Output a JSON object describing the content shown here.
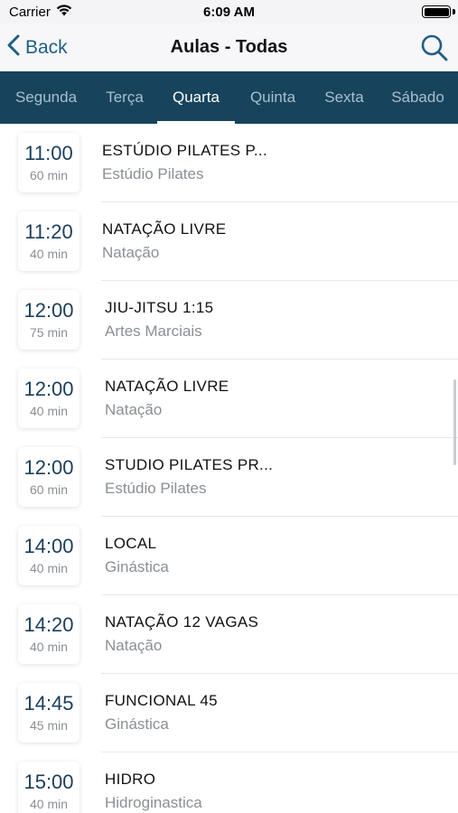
{
  "status_bar": {
    "carrier": "Carrier",
    "time": "6:09 AM",
    "icons": [
      "wifi-icon",
      "battery-icon"
    ]
  },
  "nav": {
    "back_label": "Back",
    "title": "Aulas - Todas",
    "icons": [
      "chevron-left-icon",
      "search-icon"
    ]
  },
  "day_tabs": [
    {
      "label": "Segunda",
      "active": false
    },
    {
      "label": "Terça",
      "active": false
    },
    {
      "label": "Quarta",
      "active": true
    },
    {
      "label": "Quinta",
      "active": false
    },
    {
      "label": "Sexta",
      "active": false
    },
    {
      "label": "Sábado",
      "active": false
    }
  ],
  "classes": [
    {
      "time": "11:00",
      "duration": "60 min",
      "name": "ESTÚDIO PILATES P...",
      "category": "Estúdio Pilates"
    },
    {
      "time": "11:20",
      "duration": "40 min",
      "name": "NATAÇÃO LIVRE",
      "category": "Natação"
    },
    {
      "time": "12:00",
      "duration": "75 min",
      "name": "JIU-JITSU 1:15",
      "category": "Artes Marciais"
    },
    {
      "time": "12:00",
      "duration": "40 min",
      "name": "NATAÇÃO LIVRE",
      "category": "Natação"
    },
    {
      "time": "12:00",
      "duration": "60 min",
      "name": "STUDIO PILATES PR...",
      "category": "Estúdio Pilates"
    },
    {
      "time": "14:00",
      "duration": "40 min",
      "name": "LOCAL",
      "category": "Ginástica"
    },
    {
      "time": "14:20",
      "duration": "40 min",
      "name": "NATAÇÃO 12 VAGAS",
      "category": "Natação"
    },
    {
      "time": "14:45",
      "duration": "45 min",
      "name": "FUNCIONAL 45",
      "category": "Ginástica"
    },
    {
      "time": "15:00",
      "duration": "40 min",
      "name": "HIDRO",
      "category": "Hidroginastica"
    }
  ],
  "colors": {
    "tab_bar_bg": "#17435d",
    "accent": "#1e5e86",
    "time_text": "#1a3e5c"
  }
}
